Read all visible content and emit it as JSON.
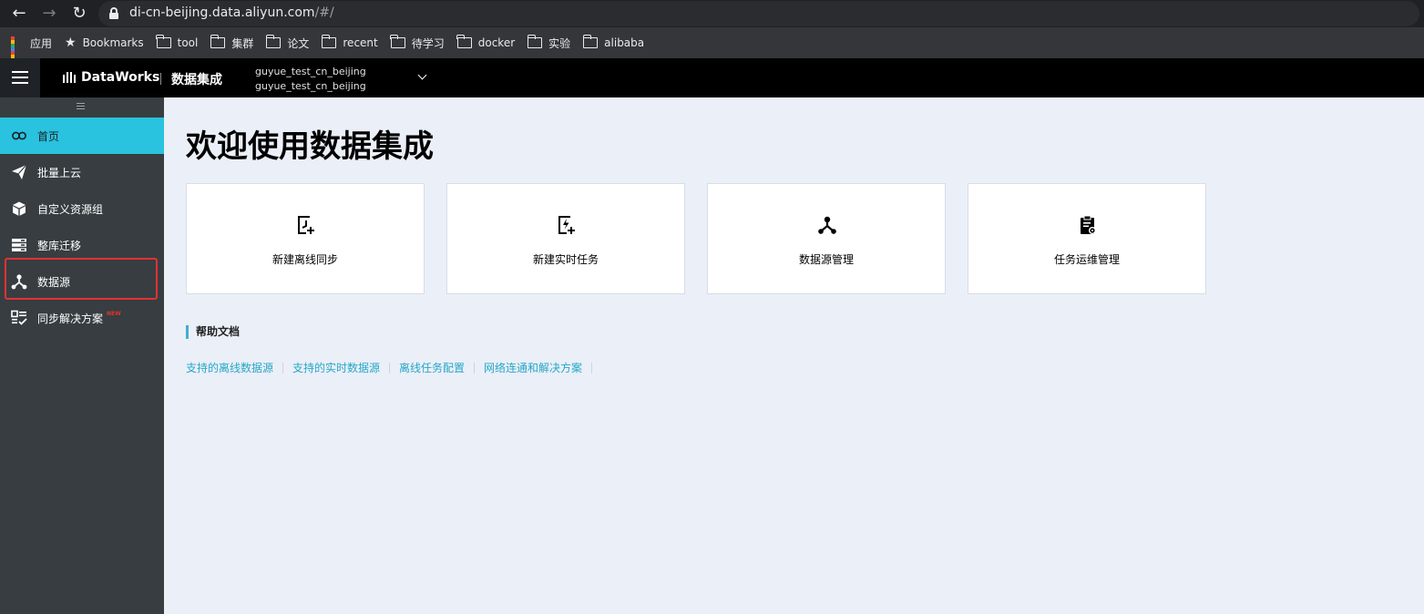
{
  "browser": {
    "url_host": "di-cn-beijing.data.aliyun.com",
    "url_path": "/#/",
    "bookmarks": [
      {
        "label": "应用",
        "icon": "apps-grid-icon"
      },
      {
        "label": "Bookmarks",
        "icon": "star-icon"
      },
      {
        "label": "tool",
        "icon": "folder-icon"
      },
      {
        "label": "集群",
        "icon": "folder-icon"
      },
      {
        "label": "论文",
        "icon": "folder-icon"
      },
      {
        "label": "recent",
        "icon": "folder-icon"
      },
      {
        "label": "待学习",
        "icon": "folder-icon"
      },
      {
        "label": "docker",
        "icon": "folder-icon"
      },
      {
        "label": "实验",
        "icon": "folder-icon"
      },
      {
        "label": "alibaba",
        "icon": "folder-icon"
      }
    ]
  },
  "header": {
    "brand": "DataWorks",
    "product": "数据集成",
    "workspace_line1": "guyue_test_cn_beijing",
    "workspace_line2": "guyue_test_cn_beijing"
  },
  "sidebar": {
    "items": [
      {
        "label": "首页",
        "icon": "home-loop-icon",
        "active": true
      },
      {
        "label": "批量上云",
        "icon": "paper-plane-icon"
      },
      {
        "label": "自定义资源组",
        "icon": "cube-icon"
      },
      {
        "label": "整库迁移",
        "icon": "server-stack-icon"
      },
      {
        "label": "数据源",
        "icon": "data-source-icon",
        "highlighted": true
      },
      {
        "label": "同步解决方案",
        "icon": "solution-checklist-icon",
        "badge": "NEW"
      }
    ],
    "active_color": "#29c2df",
    "highlight_color": "#e23232"
  },
  "main": {
    "title": "欢迎使用数据集成",
    "cards": [
      {
        "label": "新建离线同步",
        "icon": "offline-sync-icon"
      },
      {
        "label": "新建实时任务",
        "icon": "realtime-task-icon"
      },
      {
        "label": "数据源管理",
        "icon": "data-source-icon"
      },
      {
        "label": "任务运维管理",
        "icon": "task-ops-icon"
      }
    ],
    "help_title": "帮助文档",
    "help_links": [
      "支持的离线数据源",
      "支持的实时数据源",
      "离线任务配置",
      "网络连通和解决方案"
    ],
    "link_color": "#25a7c9"
  }
}
